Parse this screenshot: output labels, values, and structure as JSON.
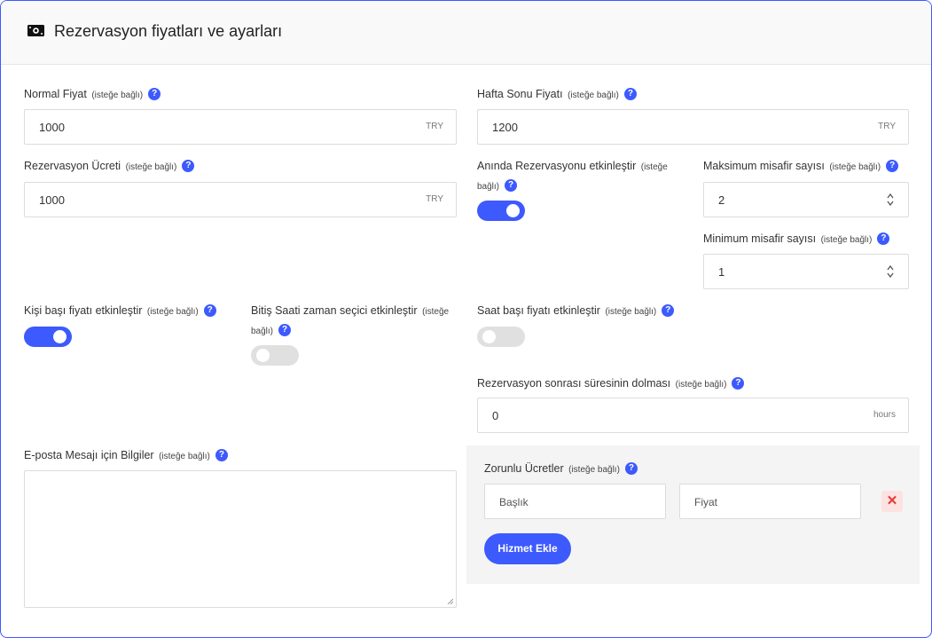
{
  "header": {
    "title": "Rezervasyon fiyatları ve ayarları",
    "icon": "money-icon"
  },
  "optional_text": "(isteğe bağlı)",
  "help_glyph": "?",
  "normal_price": {
    "label": "Normal Fiyat",
    "value": "1000",
    "unit": "TRY"
  },
  "weekend_price": {
    "label": "Hafta Sonu Fiyatı",
    "value": "1200",
    "unit": "TRY"
  },
  "booking_fee": {
    "label": "Rezervasyon Ücreti",
    "value": "1000",
    "unit": "TRY"
  },
  "instant_booking": {
    "label": "Anında Rezervasyonu etkinleştir",
    "enabled": true
  },
  "max_guests": {
    "label": "Maksimum misafir sayısı",
    "value": "2"
  },
  "min_guests": {
    "label": "Minimum misafir sayısı",
    "value": "1"
  },
  "per_person_price": {
    "label": "Kişi başı fiyatı etkinleştir",
    "enabled": true
  },
  "end_time_picker": {
    "label": "Bitiş Saati zaman seçici etkinleştir",
    "enabled": false
  },
  "hourly_price": {
    "label": "Saat başı fiyatı etkinleştir",
    "enabled": false
  },
  "booking_expiry": {
    "label": "Rezervasyon sonrası süresinin dolması",
    "value": "0",
    "unit": "hours"
  },
  "email_info": {
    "label": "E-posta Mesajı için Bilgiler",
    "value": ""
  },
  "mandatory_fees": {
    "label": "Zorunlu Ücretler",
    "title_placeholder": "Başlık",
    "price_placeholder": "Fiyat",
    "remove_glyph": "✕",
    "add_button": "Hizmet Ekle"
  },
  "colors": {
    "accent": "#3d5afe",
    "toggle_off": "#e0e0e0",
    "danger": "#e53935",
    "danger_bg": "#fde2e2"
  }
}
